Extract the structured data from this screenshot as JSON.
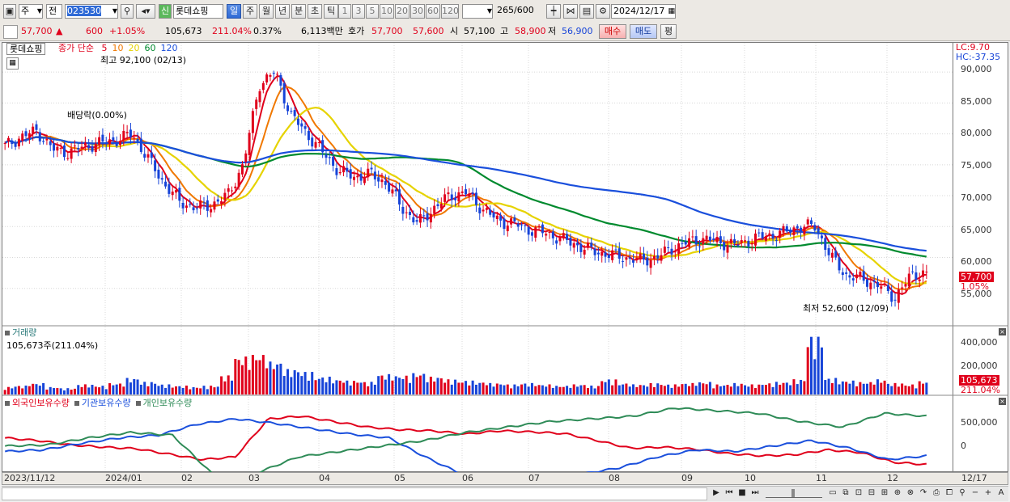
{
  "toolbar": {
    "market": "주",
    "type_sel": "전",
    "code": "023530",
    "badge": "신",
    "stock_name": "롯데쇼핑",
    "periods": [
      "일",
      "주",
      "월",
      "년",
      "분",
      "초",
      "틱"
    ],
    "period_selected": "일",
    "nums": [
      "1",
      "3",
      "5",
      "10",
      "20",
      "30",
      "60",
      "120"
    ],
    "count": "265",
    "count_max": "/600",
    "date": "2024/12/17"
  },
  "quote": {
    "price": "57,700",
    "arrow": "▲",
    "change": "600",
    "change_pct": "+1.05%",
    "volume": "105,673",
    "volume_ratio": "211.04%",
    "turnover": "0.37%",
    "amount": "6,113백만",
    "bid_label": "호가",
    "ask": "57,700",
    "bid": "57,600",
    "open_label": "시",
    "open": "57,100",
    "high_label": "고",
    "high": "58,900",
    "low_label": "저",
    "low": "56,900",
    "buy_btn": "매수",
    "sell_btn": "매도",
    "eval_btn": "평"
  },
  "chart": {
    "stock_tag": "롯데쇼핑",
    "ma_title": "종가 단순",
    "ma_periods": [
      "5",
      "10",
      "20",
      "60",
      "120"
    ],
    "ma_colors": [
      "#e0001b",
      "#f07800",
      "#e6d300",
      "#008a2e",
      "#1a4fdc"
    ],
    "max_annot": "최고 92,100 (02/13)",
    "min_annot": "최저 52,600 (12/09)",
    "div_annot": "배당락(0.00%)",
    "lc": "LC:9.70",
    "hc": "HC:-37.35",
    "current_price": "57,700",
    "current_pct": "1.05%",
    "vol_title": "거래량",
    "vol_info": "105,673주(211.04%)",
    "vol_current": "105,673",
    "vol_pct": "211.04%",
    "inv_titles": [
      "외국인보유수량",
      "기관보유수량",
      "개인보유수량"
    ],
    "inv_colors": [
      "#e0001b",
      "#1a4fdc",
      "#2e8b57"
    ]
  },
  "chart_data": {
    "type": "candlestick",
    "price_axis": [
      "90,000",
      "85,000",
      "80,000",
      "75,000",
      "70,000",
      "65,000",
      "60,000",
      "55,000"
    ],
    "price_range": [
      50000,
      92500
    ],
    "volume_axis": [
      "400,000",
      "200,000"
    ],
    "holding_axis": [
      "500,000",
      "0"
    ],
    "x_labels": [
      "2023/11/12",
      "2024/01",
      "02",
      "03",
      "04",
      "05",
      "06",
      "07",
      "08",
      "09",
      "10",
      "11",
      "12",
      "12/17"
    ],
    "close_series": [
      78000,
      79500,
      80500,
      77500,
      77000,
      78000,
      78500,
      79000,
      80000,
      76000,
      72000,
      69000,
      68000,
      68500,
      70000,
      75000,
      88000,
      90000,
      83000,
      80000,
      77000,
      74000,
      73000,
      73500,
      72000,
      68000,
      65500,
      68000,
      70000,
      70500,
      68000,
      66000,
      65500,
      64500,
      64000,
      63000,
      62000,
      61000,
      60500,
      60000,
      59500,
      60000,
      61500,
      62500,
      63000,
      62500,
      62000,
      63000,
      63500,
      64000,
      65000,
      65000,
      60000,
      57000,
      56500,
      55500,
      53500,
      57000,
      57700
    ],
    "volume_series": [
      60000,
      70000,
      90000,
      60000,
      50000,
      80000,
      70000,
      90000,
      130000,
      100000,
      80000,
      70000,
      60000,
      70000,
      150000,
      300000,
      320000,
      260000,
      200000,
      180000,
      140000,
      120000,
      110000,
      100000,
      160000,
      150000,
      170000,
      140000,
      120000,
      110000,
      100000,
      90000,
      80000,
      90000,
      80000,
      70000,
      80000,
      70000,
      120000,
      90000,
      80000,
      90000,
      80000,
      90000,
      100000,
      80000,
      90000,
      80000,
      90000,
      100000,
      120000,
      460000,
      130000,
      110000,
      100000,
      120000,
      90000,
      80000,
      105673
    ],
    "foreign_holding": [
      250000,
      200000,
      120000,
      80000,
      50000,
      -50000,
      -150000,
      -100000,
      600000,
      650000,
      550000,
      450000,
      400000,
      380000,
      320000,
      380000,
      360000,
      330000,
      200000,
      60000,
      80000,
      40000,
      -40000,
      -80000,
      -60000,
      30000,
      -20000,
      -200000,
      -240000
    ],
    "institution_holding": [
      0,
      30000,
      150000,
      250000,
      300000,
      500000,
      600000,
      520000,
      420000,
      320000,
      250000,
      -120000,
      -450000,
      -500000,
      -500000,
      -420000,
      -300000,
      -100000,
      30000,
      0,
      100000,
      200000,
      60000,
      -150000,
      -80000
    ],
    "individual_holding": [
      100000,
      120000,
      250000,
      350000,
      300000,
      -450000,
      -400000,
      -100000,
      0,
      100000,
      200000,
      350000,
      450000,
      550000,
      600000,
      650000,
      800000,
      750000,
      700000,
      550000,
      450000,
      700000,
      650000
    ]
  }
}
